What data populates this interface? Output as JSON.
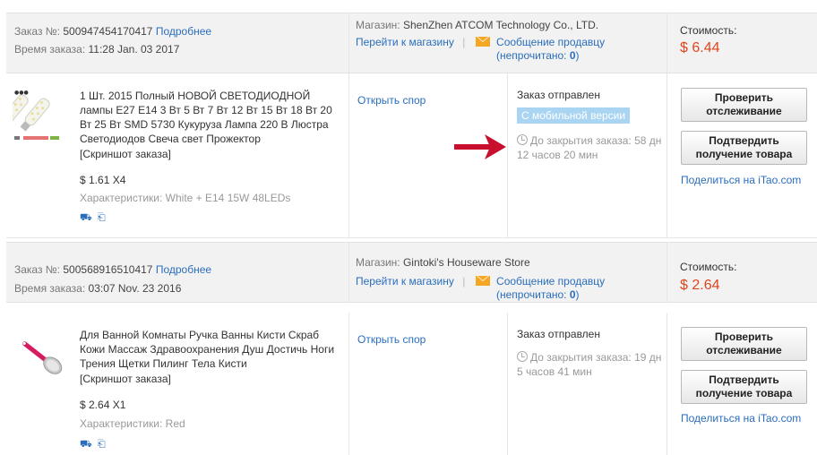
{
  "labels": {
    "order_no": "Заказ №:",
    "details": "Подробнее",
    "order_time": "Время заказа:",
    "store": "Магазин:",
    "go_to_store": "Перейти к магазину",
    "separator": "|",
    "message_seller": "Сообщение продавцу",
    "unread_prefix": "(непрочитано:",
    "unread_suffix": ")",
    "cost": "Стоимость:",
    "snapshot": "[Скриншот заказа]",
    "attributes_prefix": "Характеристики:",
    "open_dispute": "Открыть спор",
    "order_shipped": "Заказ отправлен",
    "track_button": "Проверить отслеживание",
    "confirm_button": "Подтвердить получение товара",
    "share_prefix": "Поделиться на",
    "share_brand": "iTao.com"
  },
  "colors": {
    "link": "#2a6ebb",
    "price": "#e0441c",
    "header_bg": "#f2f2f2",
    "mobile_badge": "#a9d4f2",
    "arrow": "#c8102e",
    "mail_icon": "#f5a623"
  },
  "orders": [
    {
      "number": "500947454170417",
      "time": "11:28 Jan. 03 2017",
      "store": "ShenZhen ATCOM Technology Co., LTD.",
      "unread": "0",
      "cost": "$ 6.44",
      "product": {
        "title": "1 Шт. 2015 Полный НОВОЙ СВЕТОДИОДНОЙ лампы E27 E14 3 Вт 5 Вт 7 Вт 12 Вт 15 Вт 18 Вт 20 Вт 25 Вт SMD 5730 Кукуруза Лампа 220 В Люстра Светодиодов Свеча свет Прожектор",
        "price_qty": "$ 1.61 X4",
        "attributes": "White + E14 15W 48LEDs"
      },
      "mobile_badge": "С мобильной версии",
      "timer": "До закрытия заказа: 58 дн 12 часов 20 мин"
    },
    {
      "number": "500568916510417",
      "time": "03:07 Nov. 23 2016",
      "store": "Gintoki's Houseware Store",
      "unread": "0",
      "cost": "$ 2.64",
      "product": {
        "title": "Для Ванной Комнаты Ручка Ванны Кисти Скраб Кожи Массаж Здравоохранения Душ Достичь Ноги Трения Щетки Пилинг Тела Кисти",
        "price_qty": "$ 2.64 X1",
        "attributes": "Red"
      },
      "mobile_badge": "",
      "timer": "До закрытия заказа: 19 дн 5 часов 41 мин"
    }
  ]
}
